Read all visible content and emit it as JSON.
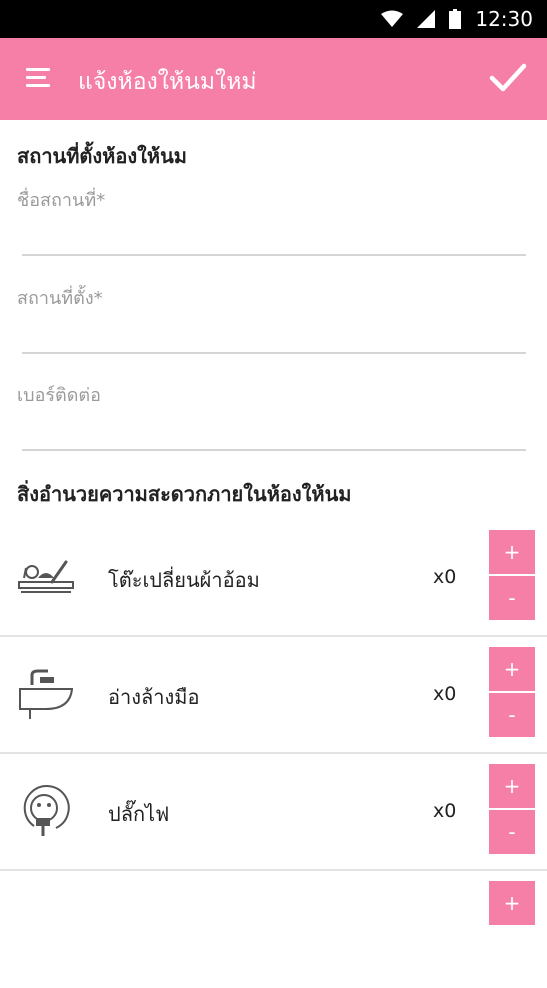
{
  "status_bar": {
    "time": "12:30",
    "icons": [
      "wifi-icon",
      "cell-signal-icon",
      "battery-icon"
    ]
  },
  "app_bar": {
    "title": "แจ้งห้องให้นมใหม่",
    "menu_icon": "hamburger-menu-icon",
    "confirm_icon": "check-icon"
  },
  "location_section": {
    "title": "สถานที่ตั้งห้องให้นม",
    "fields": [
      {
        "label": "ชื่อสถานที่*",
        "value": ""
      },
      {
        "label": "สถานที่ตั้ง*",
        "value": ""
      },
      {
        "label": "เบอร์ติดต่อ",
        "value": ""
      }
    ]
  },
  "amenities_section": {
    "title": "สิ่งอำนวยความสะดวกภายในห้องให้นม",
    "plus_label": "+",
    "minus_label": "-",
    "items": [
      {
        "name": "โต๊ะเปลี่ยนผ้าอ้อม",
        "count": "x0",
        "icon": "changing-table-icon"
      },
      {
        "name": "อ่างล้างมือ",
        "count": "x0",
        "icon": "sink-icon"
      },
      {
        "name": "ปลั๊กไฟ",
        "count": "x0",
        "icon": "power-plug-icon"
      },
      {
        "name": "",
        "count": "",
        "icon": ""
      }
    ]
  },
  "colors": {
    "accent": "#f67fa7",
    "status_bar": "#000000",
    "divider": "#e3e3e3",
    "hint_text": "#9a9a9a"
  }
}
